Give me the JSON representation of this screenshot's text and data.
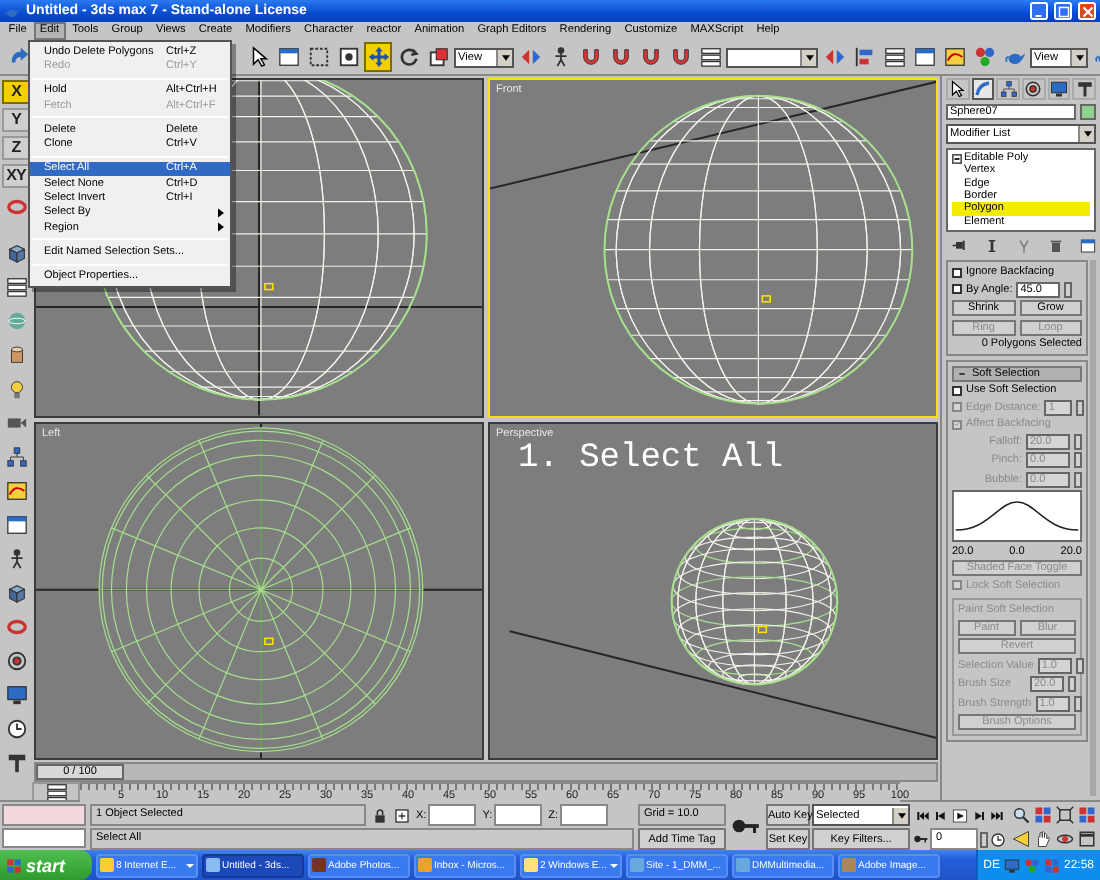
{
  "window": {
    "title": "Untitled - 3ds max 7 - Stand-alone License"
  },
  "menu_bar": [
    {
      "label": "File",
      "selected": false
    },
    {
      "label": "Edit",
      "selected": true
    },
    {
      "label": "Tools",
      "selected": false
    },
    {
      "label": "Group",
      "selected": false
    },
    {
      "label": "Views",
      "selected": false
    },
    {
      "label": "Create",
      "selected": false
    },
    {
      "label": "Modifiers",
      "selected": false
    },
    {
      "label": "Character",
      "selected": false
    },
    {
      "label": "reactor",
      "selected": false
    },
    {
      "label": "Animation",
      "selected": false
    },
    {
      "label": "Graph Editors",
      "selected": false
    },
    {
      "label": "Rendering",
      "selected": false
    },
    {
      "label": "Customize",
      "selected": false
    },
    {
      "label": "MAXScript",
      "selected": false
    },
    {
      "label": "Help",
      "selected": false
    }
  ],
  "edit_menu": [
    {
      "kind": "item",
      "label": "Undo Delete Polygons",
      "shortcut": "Ctrl+Z",
      "disabled": false,
      "highlighted": false
    },
    {
      "kind": "item",
      "label": "Redo",
      "shortcut": "Ctrl+Y",
      "disabled": true,
      "highlighted": false
    },
    {
      "kind": "separator"
    },
    {
      "kind": "item",
      "label": "Hold",
      "shortcut": "Alt+Ctrl+H",
      "disabled": false,
      "highlighted": false
    },
    {
      "kind": "item",
      "label": "Fetch",
      "shortcut": "Alt+Ctrl+F",
      "disabled": true,
      "highlighted": false
    },
    {
      "kind": "separator"
    },
    {
      "kind": "item",
      "label": "Delete",
      "shortcut": "Delete",
      "disabled": false,
      "highlighted": false
    },
    {
      "kind": "item",
      "label": "Clone",
      "shortcut": "Ctrl+V",
      "disabled": false,
      "highlighted": false
    },
    {
      "kind": "separator"
    },
    {
      "kind": "item",
      "label": "Select All",
      "shortcut": "Ctrl+A",
      "disabled": false,
      "highlighted": true
    },
    {
      "kind": "item",
      "label": "Select None",
      "shortcut": "Ctrl+D",
      "disabled": false,
      "highlighted": false
    },
    {
      "kind": "item",
      "label": "Select Invert",
      "shortcut": "Ctrl+I",
      "disabled": false,
      "highlighted": false
    },
    {
      "kind": "submenu",
      "label": "Select By",
      "disabled": false,
      "highlighted": false
    },
    {
      "kind": "submenu",
      "label": "Region",
      "disabled": false,
      "highlighted": false
    },
    {
      "kind": "separator"
    },
    {
      "kind": "item",
      "label": "Edit Named Selection Sets...",
      "disabled": false,
      "highlighted": false
    },
    {
      "kind": "separator"
    },
    {
      "kind": "item",
      "label": "Object Properties...",
      "disabled": false,
      "highlighted": false
    }
  ],
  "toolbar": {
    "transform_tools": [
      {
        "kind": "move",
        "selected": true
      },
      {
        "kind": "rotate",
        "selected": false
      },
      {
        "kind": "scale",
        "selected": false
      }
    ],
    "view_dropdown": "View",
    "panel_view_dropdown": "View"
  },
  "axis_constraints": [
    {
      "label": "X",
      "selected": true
    },
    {
      "label": "Y",
      "selected": false
    },
    {
      "label": "Z",
      "selected": false
    },
    {
      "label": "XY",
      "selected": false
    }
  ],
  "viewports": [
    {
      "kind": "top",
      "active": false
    },
    {
      "kind": "front",
      "label": "Front",
      "active": true
    },
    {
      "kind": "left",
      "label": "Left",
      "active": false
    },
    {
      "kind": "perspective",
      "label": "Perspective",
      "active": false,
      "caption": "1. Select All"
    }
  ],
  "time_slider": {
    "text": "0 / 100",
    "level": 0
  },
  "ruler": [
    "5",
    "10",
    "15",
    "20",
    "25",
    "30",
    "35",
    "40",
    "45",
    "50",
    "55",
    "60",
    "65",
    "70",
    "75",
    "80",
    "85",
    "90",
    "95",
    "100"
  ],
  "command_panel": {
    "tabs": [
      {
        "kind": "cursor",
        "selected": false
      },
      {
        "kind": "bend",
        "selected": true
      },
      {
        "kind": "hierarchy",
        "selected": false
      },
      {
        "kind": "target",
        "selected": false
      },
      {
        "kind": "monitor",
        "selected": false
      },
      {
        "kind": "hammer",
        "selected": false
      }
    ],
    "object_name": "Sphere07",
    "modifier_list": "Modifier List",
    "stack": [
      {
        "label": "Editable Poly",
        "expanded": true,
        "children": [
          {
            "label": "Vertex",
            "selected": false
          },
          {
            "label": "Edge",
            "selected": false
          },
          {
            "label": "Border",
            "selected": false
          },
          {
            "label": "Polygon",
            "selected": true
          },
          {
            "label": "Element",
            "selected": false
          }
        ]
      }
    ],
    "selection": {
      "ignore_backfacing": {
        "label": "Ignore Backfacing",
        "checked": false
      },
      "by_angle": {
        "label": "By Angle:",
        "checked": false,
        "value": "45.0"
      },
      "buttons": [
        {
          "label": "Shrink",
          "disabled": false
        },
        {
          "label": "Grow",
          "disabled": false
        },
        {
          "label": "Ring",
          "disabled": true
        },
        {
          "label": "Loop",
          "disabled": true
        }
      ],
      "info": "0 Polygons Selected"
    },
    "soft_selection": {
      "title": "Soft Selection",
      "expanded": true,
      "use_soft": {
        "label": "Use Soft Selection",
        "checked": false
      },
      "disabled": true,
      "edge_distance": {
        "label": "Edge Distance:",
        "checked": false,
        "value": "1"
      },
      "affect_backfacing": {
        "label": "Affect Backfacing",
        "checked": true
      },
      "params": [
        {
          "label": "Falloff:",
          "value": "20.0"
        },
        {
          "label": "Pinch:",
          "value": "0.0"
        },
        {
          "label": "Bubble:",
          "value": "0.0"
        }
      ],
      "curve_labels": [
        "20.0",
        "0.0",
        "20.0"
      ],
      "shaded_face_toggle": "Shaded Face Toggle",
      "lock": {
        "label": "Lock Soft Selection",
        "checked": false
      },
      "paint": {
        "title": "Paint Soft Selection",
        "buttons": [
          "Paint",
          "Blur",
          "Revert"
        ],
        "params": [
          {
            "label": "Selection Value",
            "value": "1.0"
          },
          {
            "label": "Brush Size",
            "value": "20.0"
          },
          {
            "label": "Brush Strength",
            "value": "1.0"
          }
        ],
        "options": "Brush Options"
      }
    }
  },
  "status_bar": {
    "selection_info": "1 Object Selected",
    "prompt": "Select All",
    "coords": [
      {
        "label": "X:"
      },
      {
        "label": "Y:"
      },
      {
        "label": "Z:"
      }
    ],
    "grid": "Grid = 10.0",
    "add_time_tag": "Add Time Tag",
    "auto_key": "Auto Key",
    "key_mode": "Selected",
    "set_key": "Set Key",
    "key_filters": "Key Filters...",
    "frame": "0"
  },
  "taskbar": {
    "start": "start",
    "tasks": [
      {
        "label": "8 Internet E...",
        "grouped": true,
        "active": false
      },
      {
        "label": "Untitled - 3ds...",
        "grouped": false,
        "active": true
      },
      {
        "label": "Adobe Photos...",
        "grouped": false,
        "active": false
      },
      {
        "label": "Inbox - Micros...",
        "grouped": false,
        "active": false
      },
      {
        "label": "2 Windows E...",
        "grouped": true,
        "active": false
      },
      {
        "label": "Site - 1_DMM_...",
        "grouped": false,
        "active": false
      },
      {
        "label": "DMMultimedia...",
        "grouped": false,
        "active": false
      },
      {
        "label": "Adobe Image...",
        "grouped": false,
        "active": false
      }
    ],
    "language": "DE",
    "clock": "22:58"
  }
}
